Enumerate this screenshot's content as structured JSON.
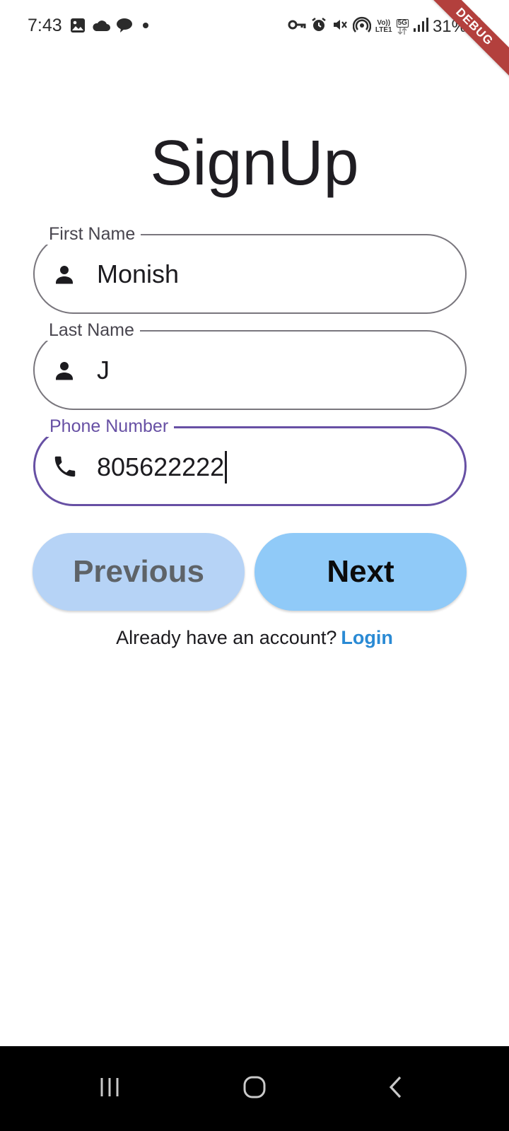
{
  "status_bar": {
    "time": "7:43",
    "battery": "31%",
    "network_tag_top": "Vo))",
    "network_tag_bottom": "LTE1",
    "network_5g": "5G",
    "left_icons": [
      "gallery-icon",
      "cloud-icon",
      "chat-bubble-icon",
      "dot-icon"
    ],
    "right_icons": [
      "key-icon",
      "alarm-icon",
      "mute-icon",
      "hotspot-icon",
      "volte-icon",
      "5g-icon",
      "signal-icon",
      "battery-icon"
    ]
  },
  "debug_banner": "DEBUG",
  "page": {
    "title": "SignUp"
  },
  "form": {
    "first_name": {
      "label": "First Name",
      "value": "Monish",
      "icon": "person-icon"
    },
    "last_name": {
      "label": "Last Name",
      "value": "J",
      "icon": "person-icon"
    },
    "phone": {
      "label": "Phone Number",
      "value": "805622222",
      "icon": "phone-icon",
      "focused": true
    }
  },
  "buttons": {
    "previous": "Previous",
    "next": "Next"
  },
  "login": {
    "prompt": "Already have an account?",
    "link": "Login"
  },
  "colors": {
    "focus": "#6750a4",
    "outline": "#79767d",
    "previous_bg": "#b6d3f6",
    "next_bg": "#90caf8",
    "link": "#2a8ad4",
    "debug": "#b3403d"
  },
  "nav_bar": {
    "buttons": [
      "recents-icon",
      "home-icon",
      "back-icon"
    ]
  }
}
